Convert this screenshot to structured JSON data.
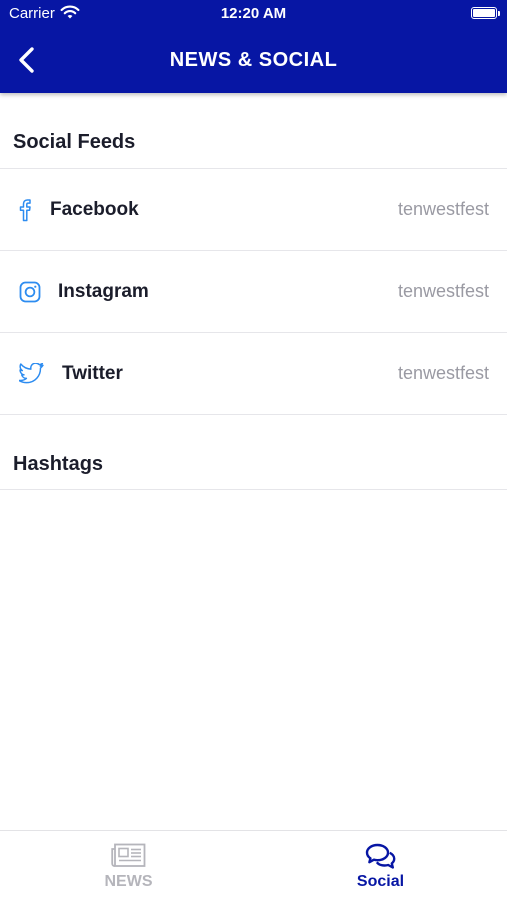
{
  "status_bar": {
    "carrier": "Carrier",
    "time": "12:20 AM"
  },
  "header": {
    "title": "NEWS & SOCIAL",
    "back_icon": "chevron-left-icon"
  },
  "social_feeds": {
    "title": "Social Feeds",
    "items": [
      {
        "label": "Facebook",
        "value": "tenwestfest",
        "icon": "facebook-icon"
      },
      {
        "label": "Instagram",
        "value": "tenwestfest",
        "icon": "instagram-icon"
      },
      {
        "label": "Twitter",
        "value": "tenwestfest",
        "icon": "twitter-icon"
      }
    ]
  },
  "hashtags": {
    "title": "Hashtags"
  },
  "tabbar": {
    "tabs": [
      {
        "label": "NEWS",
        "icon": "newspaper-icon",
        "active": false
      },
      {
        "label": "Social",
        "icon": "chat-bubbles-icon",
        "active": true
      }
    ]
  },
  "colors": {
    "header_bg": "#0716a4",
    "accent": "#0716a4",
    "icon_blue": "#2d8cf0",
    "muted": "#9a9aa3",
    "inactive_tab": "#b5b5bb"
  }
}
